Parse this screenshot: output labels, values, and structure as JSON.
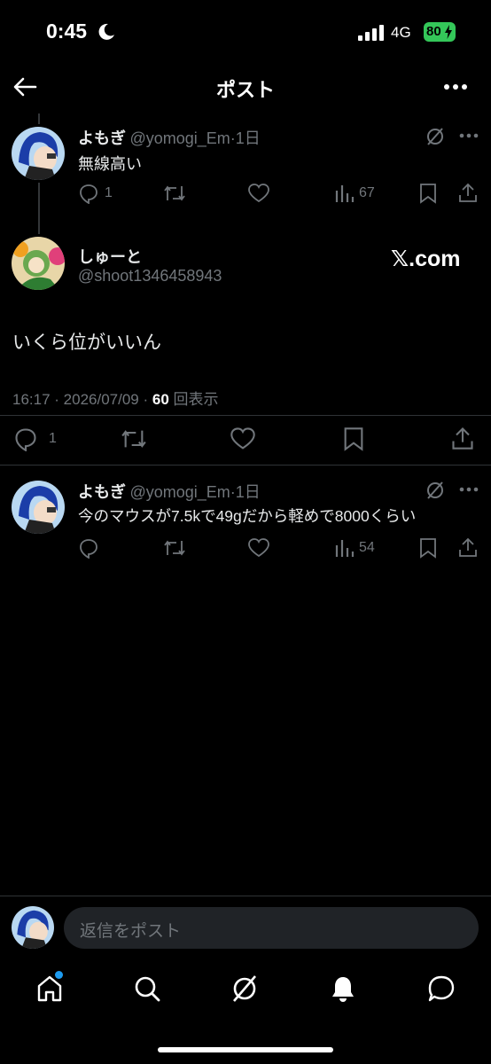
{
  "status": {
    "time": "0:45",
    "network": "4G",
    "battery": "80"
  },
  "header": {
    "title": "ポスト"
  },
  "post1": {
    "name": "よもぎ",
    "handle": "@yomogi_Em",
    "time": "1日",
    "text": "無線高い",
    "replies": "1",
    "views": "67"
  },
  "main": {
    "name": "しゅーと",
    "handle": "@shoot1346458943",
    "text": "いくら位がいいん",
    "time": "16:17",
    "date": "2026/07/09",
    "views": "60",
    "views_label": "回表示",
    "replies": "1",
    "watermark": "𝕏.com"
  },
  "reply": {
    "name": "よもぎ",
    "handle": "@yomogi_Em",
    "time": "1日",
    "text": "今のマウスが7.5kで49gだから軽めで8000くらい",
    "views": "54"
  },
  "composer": {
    "placeholder": "返信をポスト"
  },
  "colors": {
    "accent": "#1d9bf0",
    "muted": "#71767b",
    "battery": "#34c759"
  }
}
